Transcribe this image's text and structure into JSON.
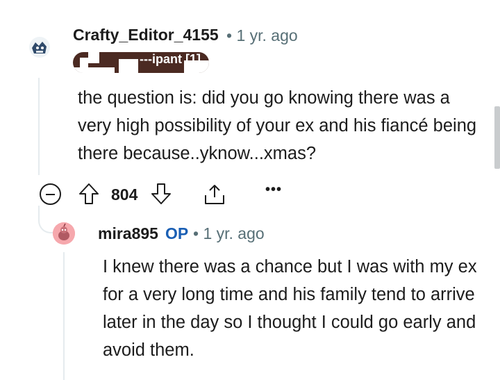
{
  "comment": {
    "author": "Crafty_Editor_4155",
    "timestamp": "• 1 yr. ago",
    "flair_text": "---ipant [1]",
    "body": "the question is: did you go knowing there was a very high possibility of your ex and his fiancé being there because..yknow...xmas?",
    "score": "804",
    "avatar_icon": "snoo-avatar-icon",
    "flair_color": "#4b2a22"
  },
  "actions": {
    "collapse_icon": "collapse-icon",
    "upvote_icon": "upvote-icon",
    "downvote_icon": "downvote-icon",
    "share_icon": "share-icon",
    "more_label": "•••"
  },
  "reply": {
    "author": "mira895",
    "op_badge": "OP",
    "timestamp": "• 1 yr. ago",
    "body": "I knew there was a chance but I was with my ex for a very long time and his family tend to arrive later in the day so I thought I could go early and avoid them.",
    "avatar_icon": "snoo-avatar-icon",
    "op_color": "#1a5fb4"
  }
}
